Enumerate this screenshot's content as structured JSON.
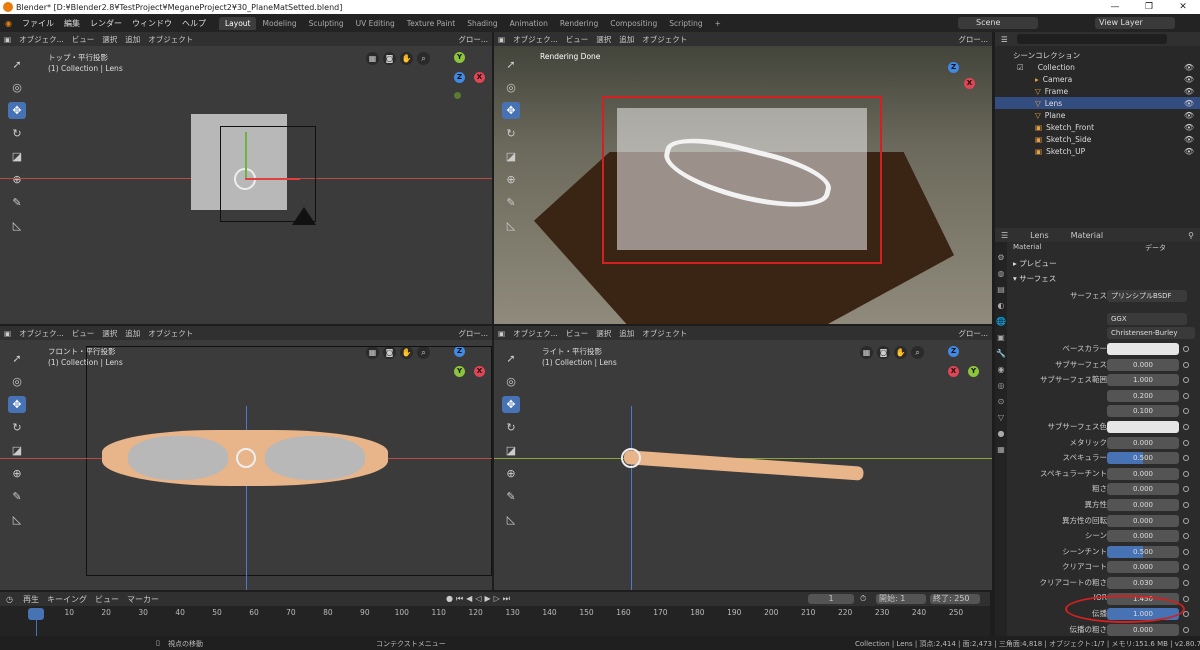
{
  "titlebar": {
    "title": "Blender* [D:¥Blender2.8¥TestProject¥MeganeProject2¥30_PlaneMatSetted.blend]",
    "minimize": "—",
    "maximize": "❐",
    "close": "✕"
  },
  "menu": {
    "items": [
      "ファイル",
      "編集",
      "レンダー",
      "ウィンドウ",
      "ヘルプ"
    ],
    "workspaces": [
      "Layout",
      "Modeling",
      "Sculpting",
      "UV Editing",
      "Texture Paint",
      "Shading",
      "Animation",
      "Rendering",
      "Compositing",
      "Scripting"
    ],
    "add_tab": "+",
    "scene": "Scene",
    "view_layer": "View Layer"
  },
  "viewport_header": {
    "mode": "オブジェク...",
    "view": "ビュー",
    "select": "選択",
    "add": "追加",
    "object": "オブジェクト",
    "transform": "グロー..."
  },
  "viewports": {
    "top_left": {
      "view_name": "トップ・平行投影",
      "collection": "(1) Collection | Lens"
    },
    "top_right": {
      "status": "Rendering Done"
    },
    "bottom_left": {
      "view_name": "フロント・平行投影",
      "collection": "(1) Collection | Lens"
    },
    "bottom_right": {
      "view_name": "ライト・平行投影",
      "collection": "(1) Collection | Lens"
    }
  },
  "gizmo_axes": {
    "x": "X",
    "y": "Y",
    "z": "Z"
  },
  "outliner": {
    "scene_collection": "シーンコレクション",
    "collection": "Collection",
    "items": [
      {
        "name": "Camera",
        "selected": false
      },
      {
        "name": "Frame",
        "selected": false
      },
      {
        "name": "Lens",
        "selected": true
      },
      {
        "name": "Plane",
        "selected": false
      },
      {
        "name": "Sketch_Front",
        "selected": false
      },
      {
        "name": "Sketch_Side",
        "selected": false
      },
      {
        "name": "Sketch_UP",
        "selected": false
      }
    ]
  },
  "properties": {
    "object": "Lens",
    "tab": "Material",
    "material_slot": "Material",
    "data_label": "データ",
    "preview": "プレビュー",
    "surface_section": "サーフェス",
    "surface_label": "サーフェス",
    "surface_value": "プリンシプルBSDF",
    "distribution": "GGX",
    "subsurface_method": "Christensen-Burley",
    "fields": [
      {
        "label": "ベースカラー",
        "value": "",
        "kind": "white"
      },
      {
        "label": "サブサーフェス",
        "value": "0.000",
        "kind": "plain"
      },
      {
        "label": "サブサーフェス範囲",
        "value": "1.000",
        "kind": "plain"
      },
      {
        "label": "",
        "value": "0.200",
        "kind": "plain"
      },
      {
        "label": "",
        "value": "0.100",
        "kind": "plain"
      },
      {
        "label": "サブサーフェス色",
        "value": "",
        "kind": "white"
      },
      {
        "label": "メタリック",
        "value": "0.000",
        "kind": "plain"
      },
      {
        "label": "スペキュラー",
        "value": "0.500",
        "kind": "blue"
      },
      {
        "label": "スペキュラーチント",
        "value": "0.000",
        "kind": "plain"
      },
      {
        "label": "粗さ",
        "value": "0.000",
        "kind": "plain"
      },
      {
        "label": "異方性",
        "value": "0.000",
        "kind": "plain"
      },
      {
        "label": "異方性の回転",
        "value": "0.000",
        "kind": "plain"
      },
      {
        "label": "シーン",
        "value": "0.000",
        "kind": "plain"
      },
      {
        "label": "シーンチント",
        "value": "0.500",
        "kind": "blue"
      },
      {
        "label": "クリアコート",
        "value": "0.000",
        "kind": "plain"
      },
      {
        "label": "クリアコートの粗さ",
        "value": "0.030",
        "kind": "plain"
      },
      {
        "label": "IOR",
        "value": "1.450",
        "kind": "plain"
      },
      {
        "label": "伝播",
        "value": "1.000",
        "kind": "full"
      },
      {
        "label": "伝播の粗さ",
        "value": "0.000",
        "kind": "plain"
      }
    ]
  },
  "timeline": {
    "menus": [
      "再生",
      "キーイング",
      "ビュー",
      "マーカー"
    ],
    "current_frame": "1",
    "start_label": "開始:",
    "start": "1",
    "end_label": "終了:",
    "end": "250",
    "ticks": [
      "1",
      "10",
      "20",
      "30",
      "40",
      "50",
      "60",
      "70",
      "80",
      "90",
      "100",
      "110",
      "120",
      "130",
      "140",
      "150",
      "160",
      "170",
      "180",
      "190",
      "200",
      "210",
      "220",
      "230",
      "240",
      "250"
    ]
  },
  "status": {
    "left": "視点の移動",
    "middle": "コンテクストメニュー",
    "right": "Collection | Lens | 頂点:2,414 | 面:2,473 | 三角面:4,818 | オブジェクト:1/7 | メモリ:151.6 MB | v2.80.75"
  },
  "colors": {
    "accent": "#4772b3",
    "annotation": "#d42020",
    "orange": "#e87d0d"
  }
}
